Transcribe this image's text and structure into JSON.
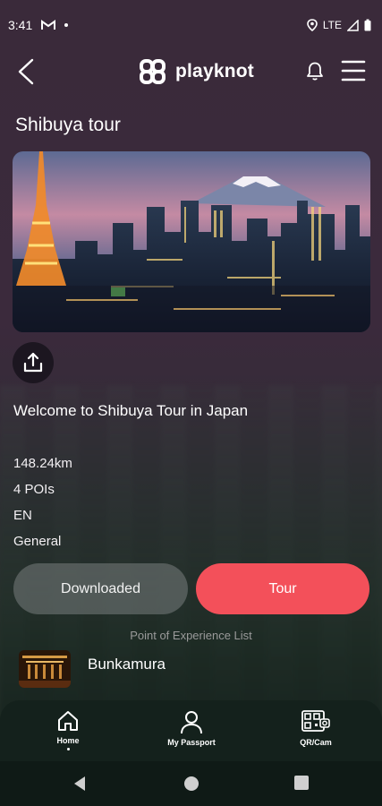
{
  "status_bar": {
    "time": "3:41",
    "network": "LTE"
  },
  "header": {
    "logo_text": "playknot",
    "icons": [
      "back-arrow-icon",
      "playknot-logo-icon",
      "bell-icon",
      "hamburger-menu-icon"
    ]
  },
  "tour": {
    "title": "Shibuya tour",
    "welcome": "Welcome to Shibuya Tour in Japan",
    "distance": "148.24km",
    "poi_count": "4 POIs",
    "language": "EN",
    "category": "General"
  },
  "actions": {
    "downloaded_label": "Downloaded",
    "tour_label": "Tour"
  },
  "poi_section": {
    "label": "Point of Experience List",
    "items": [
      {
        "name": "Bunkamura"
      }
    ]
  },
  "bottom_nav": {
    "items": [
      {
        "label": "Home",
        "icon": "home-icon"
      },
      {
        "label": "My Passport",
        "icon": "person-icon"
      },
      {
        "label": "QR/Cam",
        "icon": "qr-camera-icon"
      }
    ]
  },
  "colors": {
    "accent": "#f3505a",
    "background": "#3a2a3a",
    "bottom_nav": "#14211c"
  }
}
